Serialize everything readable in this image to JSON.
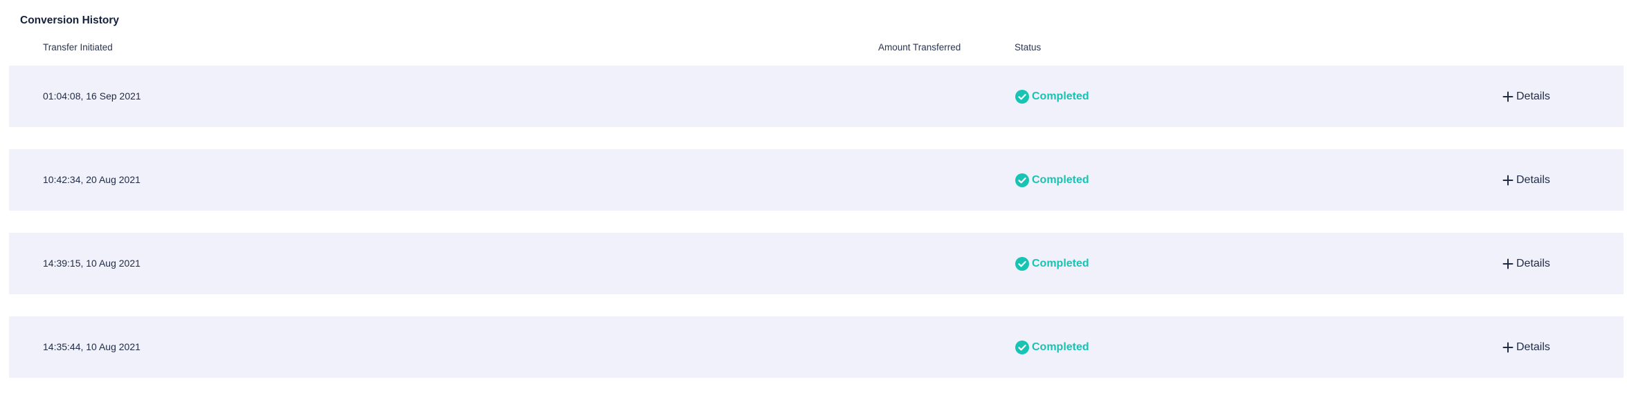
{
  "page": {
    "title": "Conversion History"
  },
  "table": {
    "headers": {
      "initiated": "Transfer Initiated",
      "amount": "Amount Transferred",
      "status": "Status"
    },
    "rows": [
      {
        "initiated": "01:04:08, 16 Sep 2021",
        "status": "Completed",
        "details_label": "Details"
      },
      {
        "initiated": "10:42:34, 20 Aug 2021",
        "status": "Completed",
        "details_label": "Details"
      },
      {
        "initiated": "14:39:15, 10 Aug 2021",
        "status": "Completed",
        "details_label": "Details"
      },
      {
        "initiated": "14:35:44, 10 Aug 2021",
        "status": "Completed",
        "details_label": "Details"
      }
    ]
  },
  "colors": {
    "status_completed": "#17c3b2",
    "row_background": "#f0f1fb",
    "text": "#1f2a44"
  },
  "icons": {
    "status": "check-circle-icon",
    "details": "plus-icon"
  }
}
